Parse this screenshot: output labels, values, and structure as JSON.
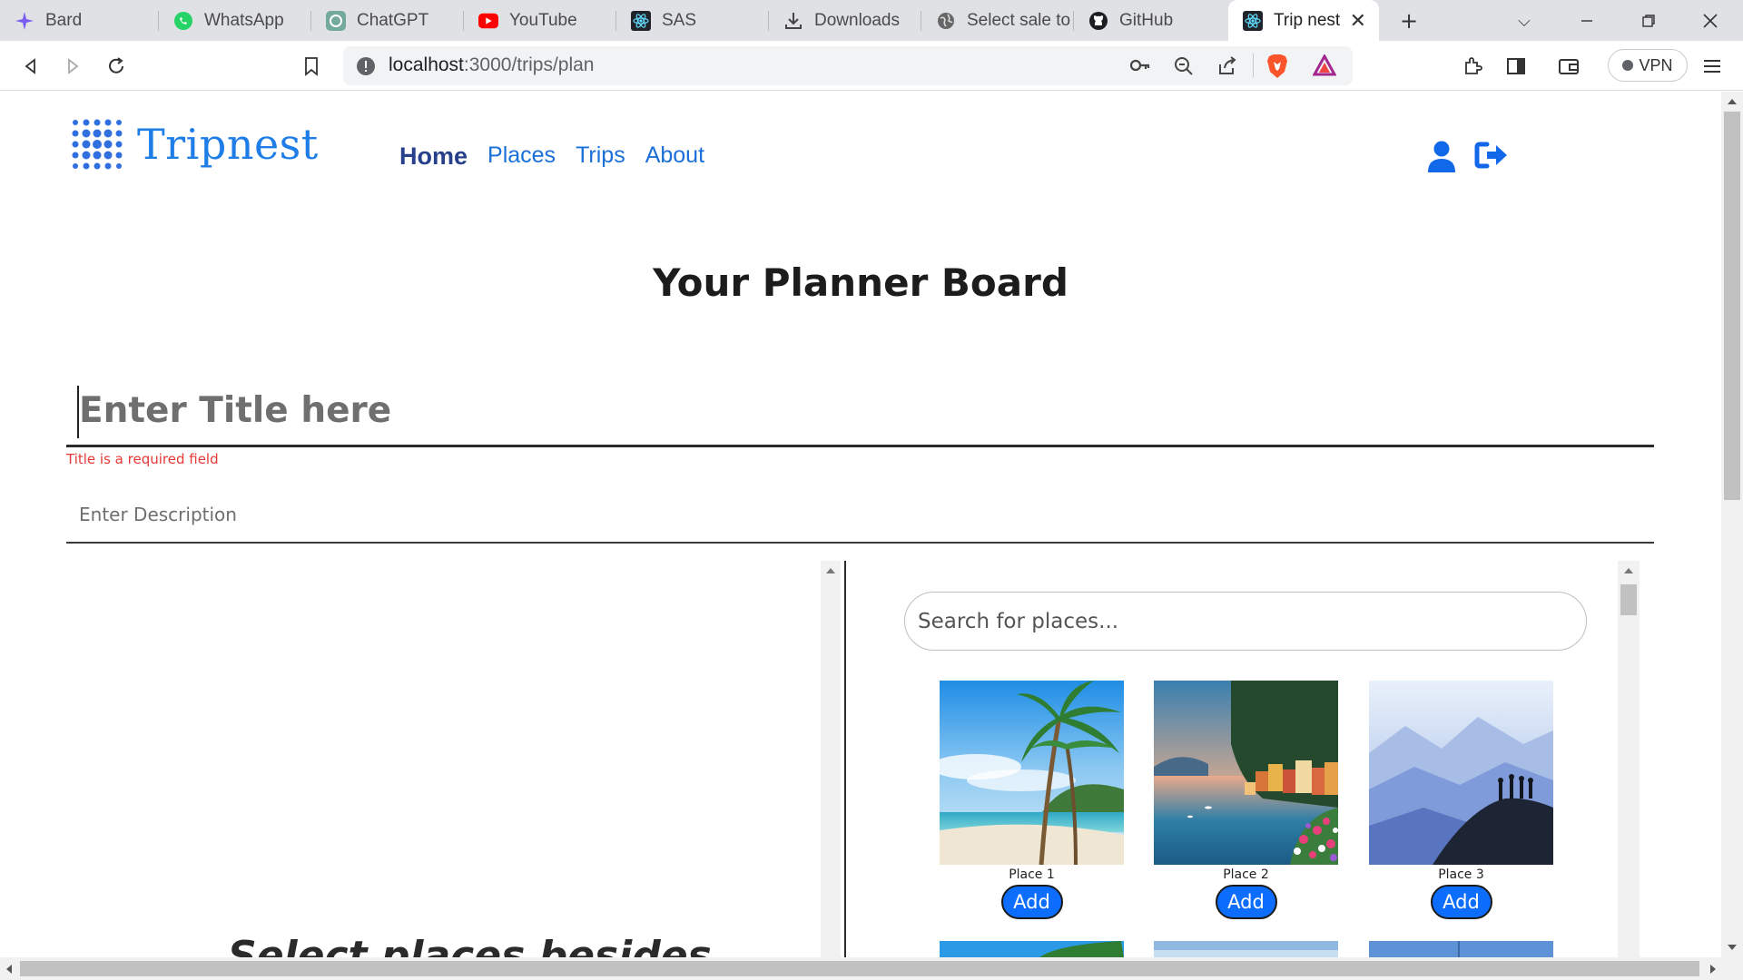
{
  "browser": {
    "tabs": [
      {
        "label": "Bard",
        "icon": "bard-icon"
      },
      {
        "label": "WhatsApp",
        "icon": "whatsapp-icon"
      },
      {
        "label": "ChatGPT",
        "icon": "chatgpt-icon"
      },
      {
        "label": "YouTube",
        "icon": "youtube-icon"
      },
      {
        "label": "SAS",
        "icon": "react-icon"
      },
      {
        "label": "Downloads",
        "icon": "download-icon"
      },
      {
        "label": "Select sale to d",
        "icon": "globe-icon"
      },
      {
        "label": "GitHub",
        "icon": "github-icon"
      },
      {
        "label": "Trip nest",
        "icon": "react-icon",
        "active": true
      }
    ],
    "url_host": "localhost",
    "url_path": ":3000/trips/plan",
    "vpn_label": "VPN"
  },
  "site": {
    "logo_text": "Tripnest",
    "nav": [
      {
        "label": "Home",
        "active": true
      },
      {
        "label": "Places"
      },
      {
        "label": "Trips"
      },
      {
        "label": "About"
      }
    ]
  },
  "planner": {
    "heading": "Your Planner Board",
    "title_placeholder": "Enter Title here",
    "title_error": "Title is a required field",
    "description_placeholder": "Enter Description",
    "left_heading_partial": "Select places besides",
    "search_placeholder": "Search for places...",
    "places": [
      {
        "name": "Place 1",
        "add_label": "Add"
      },
      {
        "name": "Place 2",
        "add_label": "Add"
      },
      {
        "name": "Place 3",
        "add_label": "Add"
      }
    ]
  },
  "colors": {
    "brand": "#1e7de6",
    "nav_active": "#27408b",
    "button": "#0d6efd",
    "error": "#e53935"
  }
}
